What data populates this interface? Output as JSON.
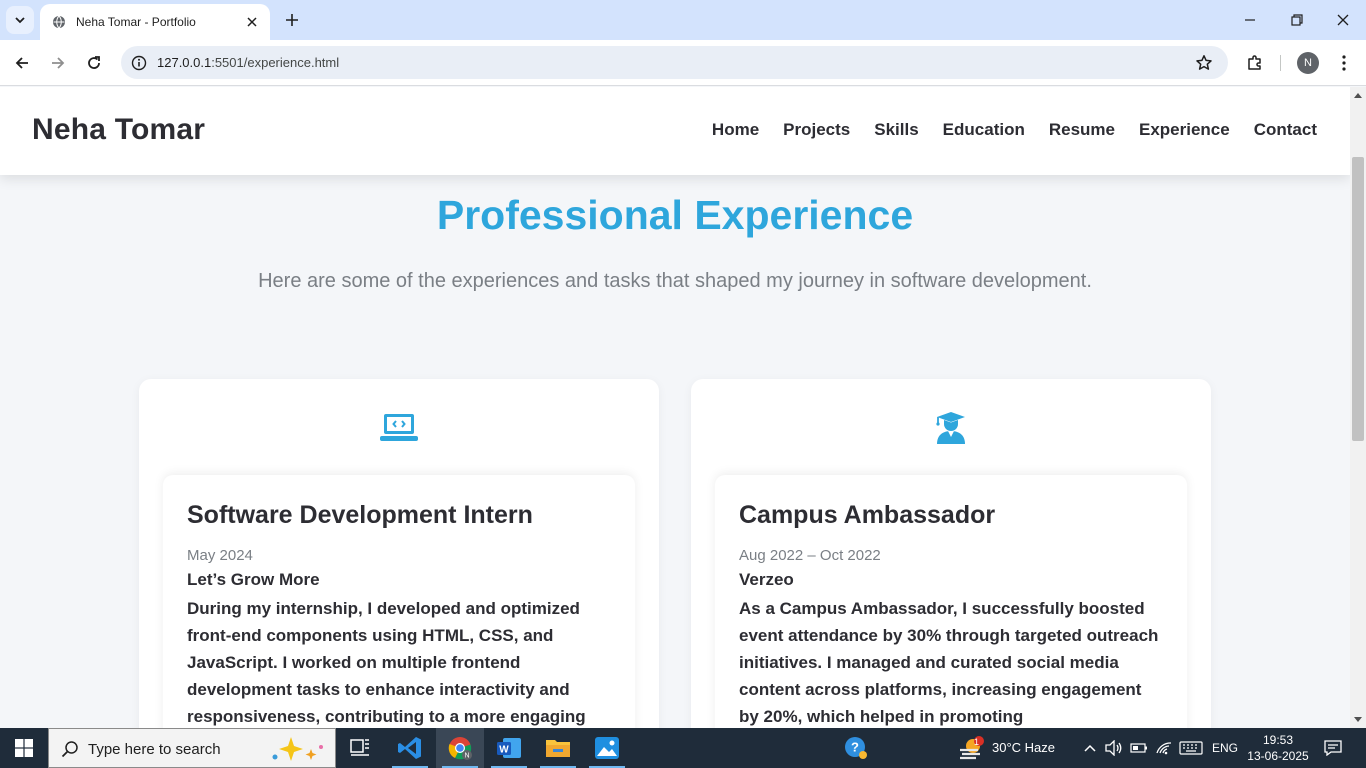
{
  "browser": {
    "tab_title": "Neha Tomar - Portfolio",
    "url_host": "127.0.0.1",
    "url_path": ":5501/experience.html",
    "profile_initial": "N"
  },
  "site": {
    "brand": "Neha Tomar",
    "nav": [
      "Home",
      "Projects",
      "Skills",
      "Education",
      "Resume",
      "Experience",
      "Contact"
    ]
  },
  "section": {
    "title": "Professional Experience",
    "subtitle": "Here are some of the experiences and tasks that shaped my journey in software development."
  },
  "experiences": [
    {
      "icon": "laptop-code-icon",
      "role": "Software Development Intern",
      "date": "May 2024",
      "company": "Let’s Grow More",
      "description": "During my internship, I developed and optimized front-end components using HTML, CSS, and JavaScript. I worked on multiple frontend development tasks to enhance interactivity and responsiveness, contributing to a more engaging"
    },
    {
      "icon": "graduate-icon",
      "role": "Campus Ambassador",
      "date": "Aug 2022 – Oct 2022",
      "company": "Verzeo",
      "description": "As a Campus Ambassador, I successfully boosted event attendance by 30% through targeted outreach initiatives. I managed and curated social media content across platforms, increasing engagement by 20%, which helped in promoting"
    }
  ],
  "taskbar": {
    "search_placeholder": "Type here to search",
    "weather": "30°C  Haze",
    "weather_badge": "1",
    "language": "ENG",
    "time": "19:53",
    "date": "13-06-2025"
  },
  "colors": {
    "accent": "#2ea6dc",
    "text_dark": "#2d2d33",
    "text_muted": "#7a7f85",
    "page_bg": "#f4f6f9"
  }
}
